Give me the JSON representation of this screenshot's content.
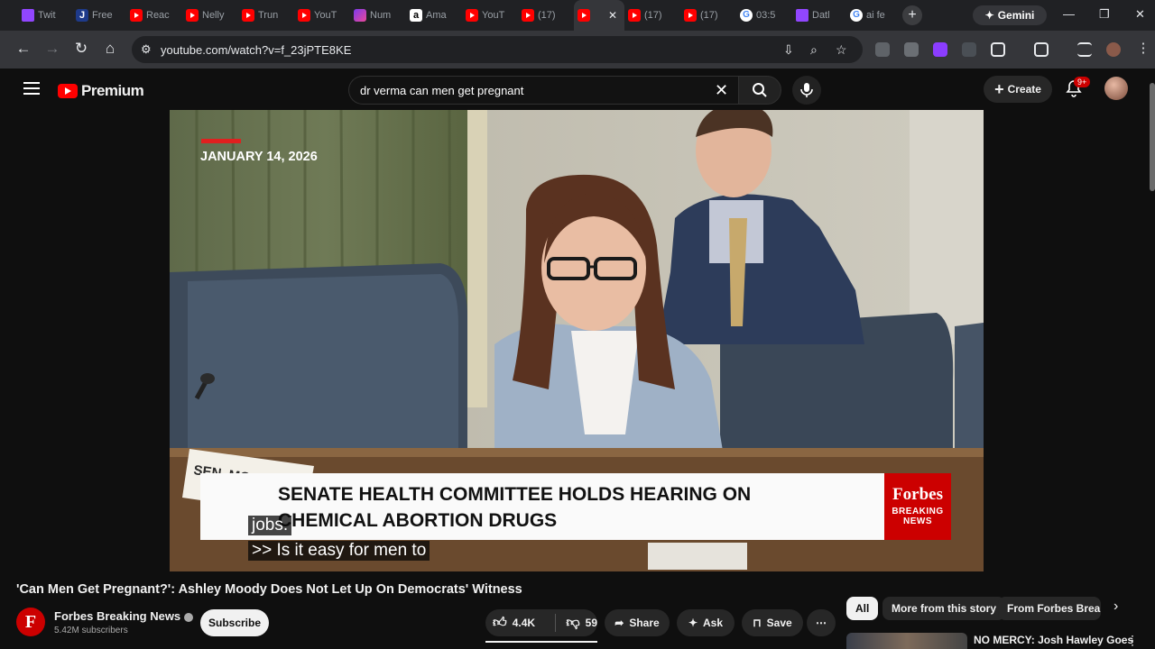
{
  "tabs": [
    {
      "label": "Twit",
      "icon": "twitch-icon"
    },
    {
      "label": "Free",
      "icon": "j-icon"
    },
    {
      "label": "Reac",
      "icon": "youtube-icon"
    },
    {
      "label": "Nelly",
      "icon": "youtube-icon"
    },
    {
      "label": "Trun",
      "icon": "youtube-icon"
    },
    {
      "label": "YouT",
      "icon": "youtube-icon"
    },
    {
      "label": "Num",
      "icon": "numerade-icon"
    },
    {
      "label": "Ama",
      "icon": "amazon-icon"
    },
    {
      "label": "YouT",
      "icon": "youtube-icon"
    },
    {
      "label": "(17)",
      "icon": "youtube-icon"
    },
    {
      "label": "",
      "icon": "youtube-icon",
      "active": true
    },
    {
      "label": "(17)",
      "icon": "youtube-icon"
    },
    {
      "label": "(17)",
      "icon": "youtube-icon"
    },
    {
      "label": "03:5",
      "icon": "google-icon"
    },
    {
      "label": "Datl",
      "icon": "twitch-icon"
    },
    {
      "label": "ai fe",
      "icon": "google-icon"
    }
  ],
  "browser": {
    "gemini_label": "Gemini",
    "url": "youtube.com/watch?v=f_23jPTE8KE"
  },
  "youtube": {
    "logo_text": "Premium",
    "search_value": "dr verma can men get pregnant",
    "create_label": "Create",
    "notifications_badge": "9+"
  },
  "video": {
    "date_overlay": "JANUARY 14, 2026",
    "lower_third_line1": "SENATE HEALTH COMMITTEE HOLDS HEARING ON",
    "lower_third_line2": "CHEMICAL ABORTION DRUGS",
    "brand_name": "Forbes",
    "brand_sub1": "BREAKING",
    "brand_sub2": "NEWS",
    "caption_line1": "jobs.",
    "caption_line2": ">> Is it easy for men to",
    "nameplate_text": "SEN. MOO"
  },
  "meta": {
    "title": "'Can Men Get Pregnant?': Ashley Moody Does Not Let Up On Democrats' Witness",
    "channel_initial": "F",
    "channel_name": "Forbes Breaking News",
    "subscribers": "5.42M subscribers",
    "subscribe_label": "Subscribe",
    "likes": "4.4K",
    "dislikes": "59",
    "share_label": "Share",
    "ask_label": "Ask",
    "save_label": "Save"
  },
  "chips": [
    "All",
    "More from this story",
    "From Forbes Breakin"
  ],
  "recommendation": {
    "title": "NO MERCY: Josh Hawley Goes"
  },
  "colors": {
    "youtube_red": "#ff0000",
    "forbes_red": "#cc0000",
    "background": "#0f0f0f"
  }
}
